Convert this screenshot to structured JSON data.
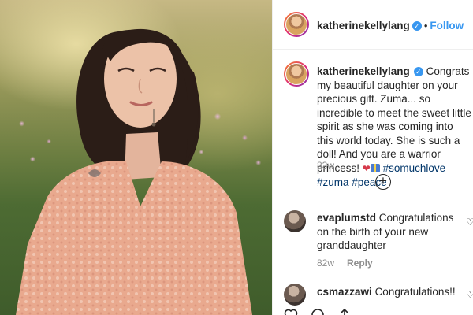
{
  "post": {
    "image_alt": "Young woman with shoulder-length dark hair in a pink sequined top, standing in a field of flowers",
    "author": "katherinekellylang",
    "verified": true,
    "separator": "•",
    "follow_label": "Follow"
  },
  "caption": {
    "username": "katherinekellylang",
    "text": "Congrats my beautiful daughter on your precious gift. Zuma... so incredible to meet the sweet little spirit as she was coming into this world today. She is such a doll! And you are a warrior princess!",
    "hashtags": [
      "#somuchlove",
      "#zuma",
      "#peace"
    ],
    "timestamp": "83w"
  },
  "comments": [
    {
      "username": "evaplumstd",
      "text": "Congratulations on the birth of your new granddaughter",
      "timestamp": "82w",
      "reply_label": "Reply"
    },
    {
      "username": "csmazzawi",
      "text": "Congratulations!!"
    }
  ],
  "icons": {
    "verified": "verified-badge-icon",
    "load_more": "plus-circle-icon",
    "comment_like": "heart-outline-icon",
    "like": "heart-outline-icon",
    "comment": "comment-bubble-icon",
    "share": "share-arrow-icon"
  },
  "colors": {
    "link": "#3897f0",
    "hashtag": "#003569",
    "muted": "#8e8e8e",
    "text": "#262626"
  }
}
